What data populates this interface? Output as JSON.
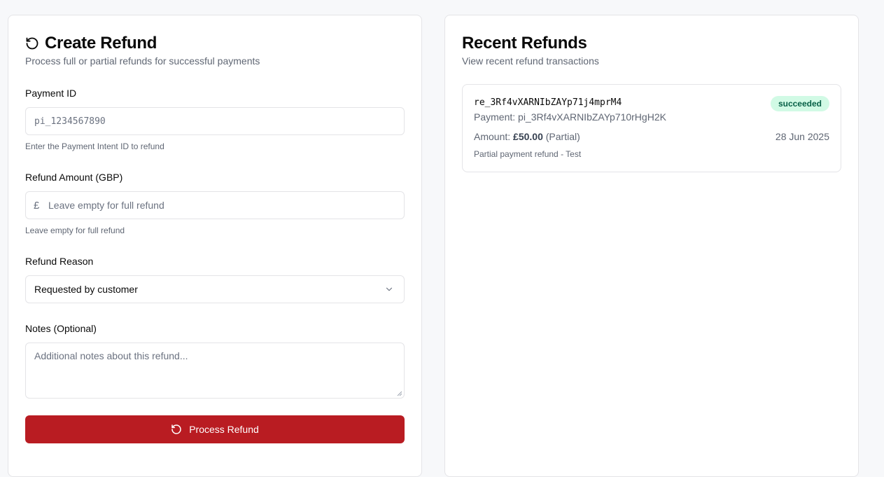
{
  "create_refund": {
    "title": "Create Refund",
    "description": "Process full or partial refunds for successful payments",
    "payment_id": {
      "label": "Payment ID",
      "placeholder": "pi_1234567890",
      "hint": "Enter the Payment Intent ID to refund"
    },
    "amount": {
      "label": "Refund Amount (GBP)",
      "currency_symbol": "£",
      "placeholder": "Leave empty for full refund",
      "hint": "Leave empty for full refund"
    },
    "reason": {
      "label": "Refund Reason",
      "selected": "Requested by customer"
    },
    "notes": {
      "label": "Notes (Optional)",
      "placeholder": "Additional notes about this refund..."
    },
    "submit_label": "Process Refund",
    "button_color": "#b91c22"
  },
  "recent_refunds": {
    "title": "Recent Refunds",
    "description": "View recent refund transactions",
    "items": [
      {
        "id": "re_3Rf4vXARNIbZAYp71j4mprM4",
        "payment": "Payment: pi_3Rf4vXARNIbZAYp710rHgH2K",
        "status": "succeeded",
        "amount_prefix": "Amount:",
        "amount": "£50.00",
        "amount_type": "(Partial)",
        "date": "28 Jun 2025",
        "note": "Partial payment refund - Test"
      }
    ]
  }
}
